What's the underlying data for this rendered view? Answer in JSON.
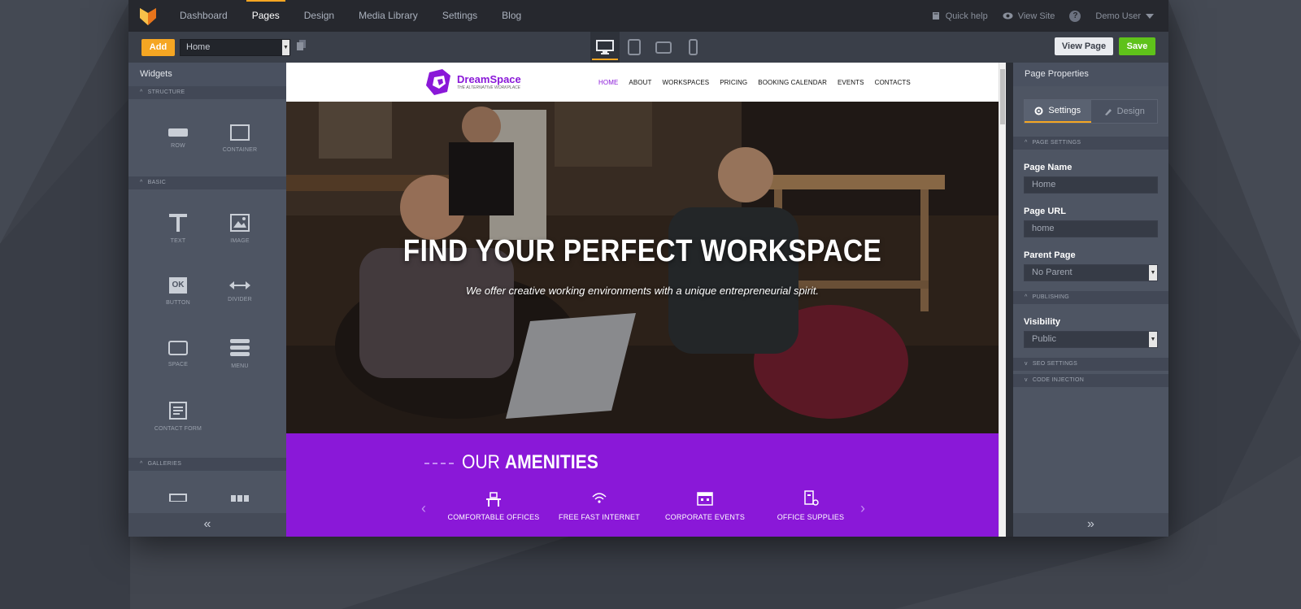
{
  "nav": {
    "items": [
      "Dashboard",
      "Pages",
      "Design",
      "Media Library",
      "Settings",
      "Blog"
    ],
    "active": "Pages",
    "quick_help": "Quick help",
    "view_site": "View Site",
    "help_glyph": "?",
    "user": "Demo User"
  },
  "toolbar": {
    "add_label": "Add",
    "page_select": "Home",
    "view_page_label": "View Page",
    "save_label": "Save",
    "devices": [
      "desktop-icon",
      "tablet-icon",
      "tablet-landscape-icon",
      "phone-icon"
    ]
  },
  "left_panel": {
    "title": "Widgets",
    "sections": {
      "structure": "STRUCTURE",
      "basic": "BASIC",
      "galleries": "GALLERIES"
    },
    "widgets": {
      "row": "ROW",
      "container": "CONTAINER",
      "text": "TEXT",
      "image": "IMAGE",
      "button": "BUTTON",
      "divider": "DIVIDER",
      "space": "SPACE",
      "menu": "MENU",
      "contact_form": "CONTACT FORM"
    },
    "button_glyph": "OK",
    "collapse_glyph": "«"
  },
  "site": {
    "brand": "DreamSpace",
    "tagline": "THE ALTERNATIVE WORKPLACE",
    "menu": [
      "HOME",
      "ABOUT",
      "WORKSPACES",
      "PRICING",
      "BOOKING CALENDAR",
      "EVENTS",
      "CONTACTS"
    ],
    "active_menu": "HOME",
    "hero_title": "FIND YOUR PERFECT WORKSPACE",
    "hero_subtitle": "We offer creative working environments with a unique entrepreneurial spirit.",
    "amenities_title_light": "OUR",
    "amenities_title_bold": "AMENITIES",
    "amenities": [
      "COMFORTABLE OFFICES",
      "FREE FAST INTERNET",
      "CORPORATE EVENTS",
      "OFFICE SUPPLIES"
    ],
    "prev_glyph": "‹",
    "next_glyph": "›",
    "accent": "#8a18d8"
  },
  "right_panel": {
    "title": "Page Properties",
    "tabs": [
      "Settings",
      "Design"
    ],
    "sections": {
      "page_settings": "PAGE SETTINGS",
      "publishing": "PUBLISHING",
      "seo_settings": "SEO SETTINGS",
      "code_injection": "CODE INJECTION"
    },
    "page_name_label": "Page Name",
    "page_name_value": "Home",
    "page_url_label": "Page URL",
    "page_url_value": "home",
    "parent_page_label": "Parent Page",
    "parent_page_value": "No Parent",
    "visibility_label": "Visibility",
    "visibility_value": "Public",
    "expand_glyph": "»"
  },
  "colors": {
    "accent_orange": "#f5a623",
    "save_green": "#5fc21a",
    "panel": "#4e5563",
    "dark": "#26282e"
  }
}
